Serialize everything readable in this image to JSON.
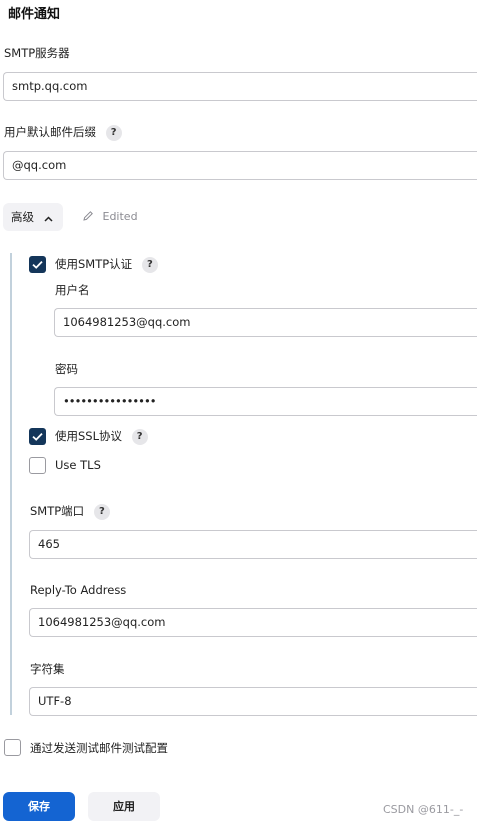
{
  "section_title": "邮件通知",
  "smtp_server": {
    "label": "SMTP服务器",
    "value": "smtp.qq.com"
  },
  "default_suffix": {
    "label": "用户默认邮件后缀",
    "help": "?",
    "value": "@qq.com"
  },
  "advanced": {
    "label": "高级",
    "chevron": "chevron-up-icon",
    "edited_label": "Edited",
    "edited_icon": "pencil-icon"
  },
  "smtp_auth": {
    "label": "使用SMTP认证",
    "help": "?",
    "checked": true,
    "username": {
      "label": "用户名",
      "value": "1064981253@qq.com"
    },
    "password": {
      "label": "密码",
      "value": "••••••••••••••••"
    }
  },
  "use_ssl": {
    "label": "使用SSL协议",
    "help": "?",
    "checked": true
  },
  "use_tls": {
    "label": "Use TLS",
    "checked": false
  },
  "smtp_port": {
    "label": "SMTP端口",
    "help": "?",
    "value": "465"
  },
  "reply_to": {
    "label": "Reply-To Address",
    "value": "1064981253@qq.com"
  },
  "charset": {
    "label": "字符集",
    "value": "UTF-8"
  },
  "test_config": {
    "label": "通过发送测试邮件测试配置",
    "checked": false
  },
  "buttons": {
    "save": "保存",
    "apply": "应用"
  },
  "watermark": "CSDN @611-_-",
  "colors": {
    "primary": "#1464d2",
    "checkbox_checked": "#14365a",
    "indent_line": "#c2d1dc"
  }
}
